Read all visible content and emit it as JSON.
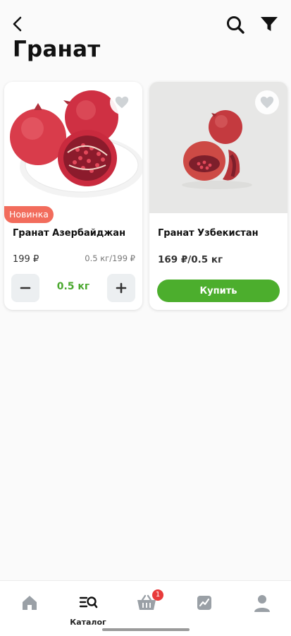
{
  "header": {
    "title": "Гранат"
  },
  "products": [
    {
      "name": "Гранат Азербайджан",
      "badge": "Новинка",
      "price": "199 ₽",
      "price_note": "0.5 кг/199 ₽",
      "quantity": "0.5 кг"
    },
    {
      "name": "Гранат Узбекистан",
      "price": "169 ₽/0.5 кг",
      "buy_label": "Купить"
    }
  ],
  "nav": {
    "items": [
      {
        "icon": "home-icon"
      },
      {
        "icon": "catalog-icon",
        "label": "Каталог"
      },
      {
        "icon": "basket-icon",
        "badge": "1"
      },
      {
        "icon": "chart-icon"
      },
      {
        "icon": "profile-icon"
      }
    ]
  },
  "colors": {
    "accent_green": "#4cae2d",
    "badge_red": "#f26c5c",
    "cart_badge": "#e83b3b"
  }
}
